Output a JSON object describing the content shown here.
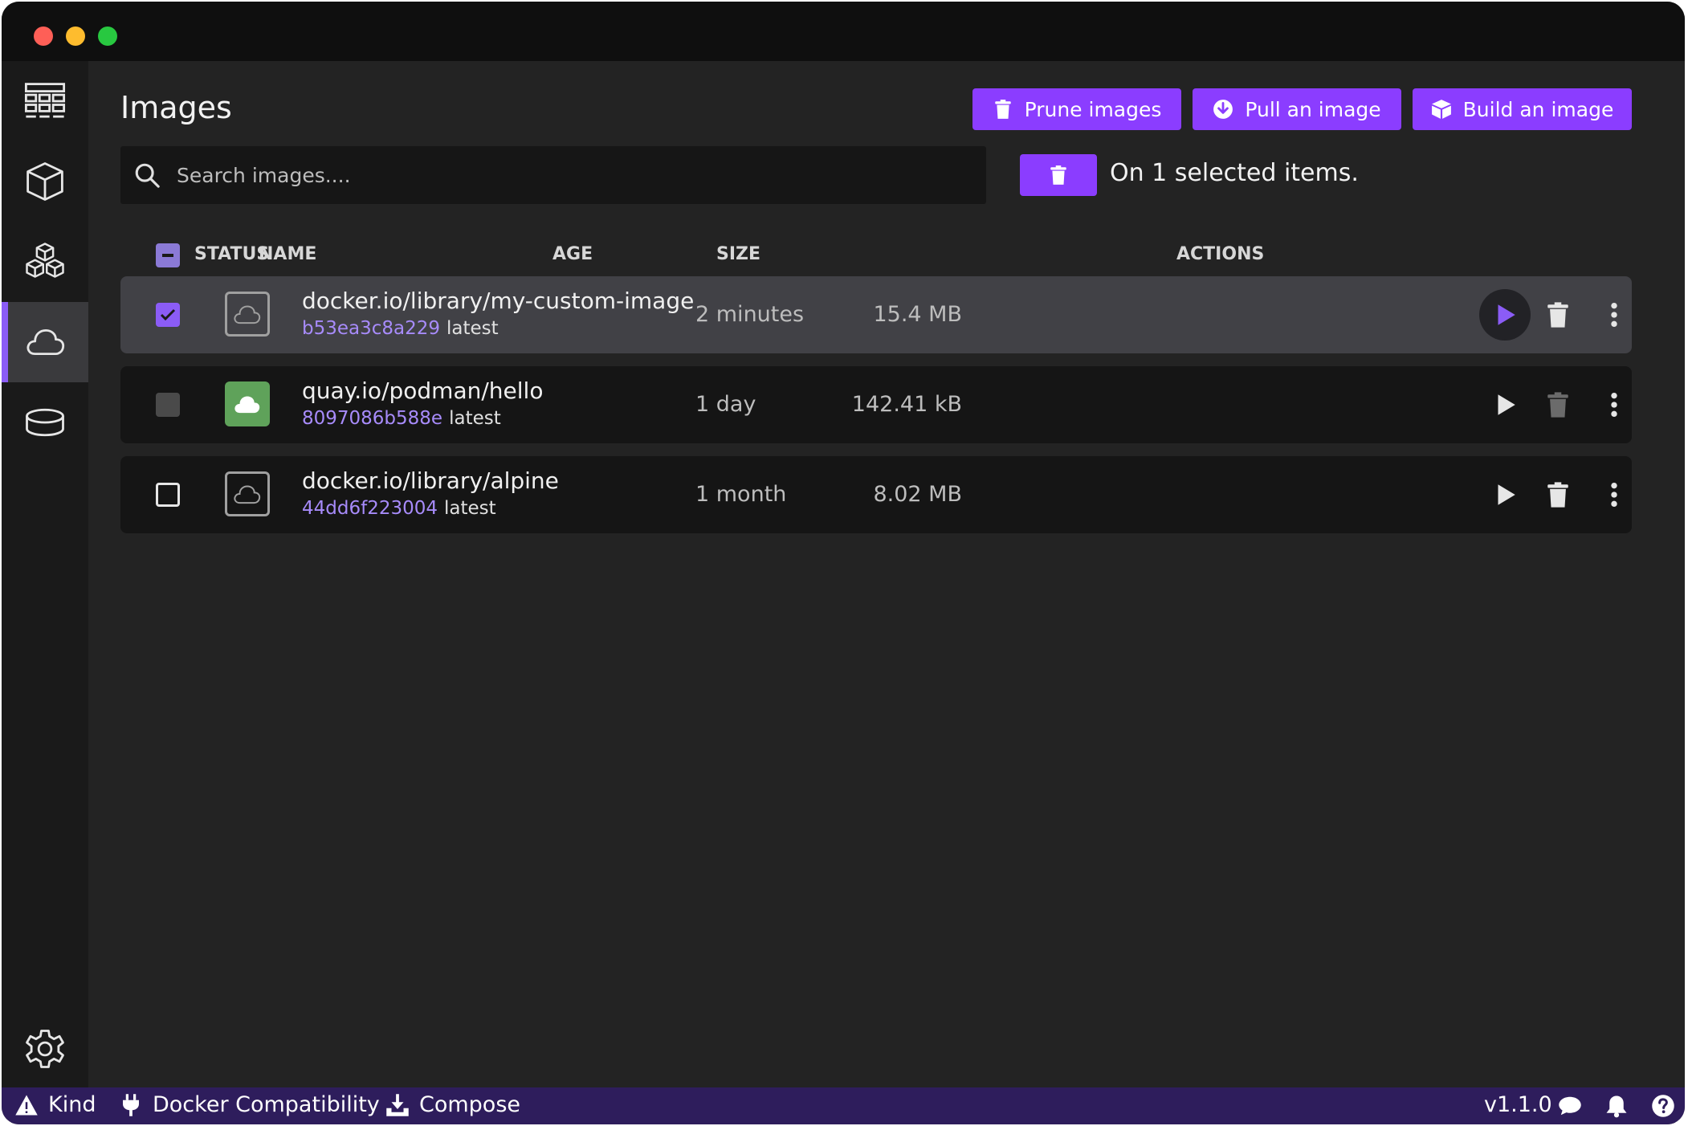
{
  "sidebar": {
    "items": [
      {
        "name": "dashboard",
        "icon": "dashboard-grid-icon"
      },
      {
        "name": "containers",
        "icon": "cube-icon"
      },
      {
        "name": "pods",
        "icon": "cubes-icon"
      },
      {
        "name": "images",
        "icon": "cloud-icon",
        "active": true
      },
      {
        "name": "volumes",
        "icon": "database-icon"
      }
    ],
    "settings_icon": "gear-icon"
  },
  "page": {
    "title": "Images",
    "buttons": {
      "prune": "Prune images",
      "pull": "Pull an image",
      "build": "Build an image"
    },
    "search_placeholder": "Search images....",
    "bulk_label": "On 1 selected items."
  },
  "table": {
    "headers": {
      "status": "STATUS",
      "name": "NAME",
      "age": "AGE",
      "size": "SIZE",
      "actions": "ACTIONS"
    },
    "rows": [
      {
        "name": "docker.io/library/my-custom-image",
        "id": "b53ea3c8a229",
        "tag": "latest",
        "age": "2 minutes",
        "size": "15.4 MB",
        "selected": true,
        "in_use": false
      },
      {
        "name": "quay.io/podman/hello",
        "id": "8097086b588e",
        "tag": "latest",
        "age": "1 day",
        "size": "142.41 kB",
        "selected": false,
        "in_use": true
      },
      {
        "name": "docker.io/library/alpine",
        "id": "44dd6f223004",
        "tag": "latest",
        "age": "1 month",
        "size": "8.02 MB",
        "selected": false,
        "in_use": false
      }
    ]
  },
  "statusbar": {
    "kind": "Kind",
    "docker_compat": "Docker Compatibility",
    "compose": "Compose",
    "version": "v1.1.0"
  },
  "colors": {
    "accent": "#8b3dff",
    "statusbar": "#2e1d5c",
    "in_use": "#5fa25a",
    "image_id": "#a78bfa"
  }
}
